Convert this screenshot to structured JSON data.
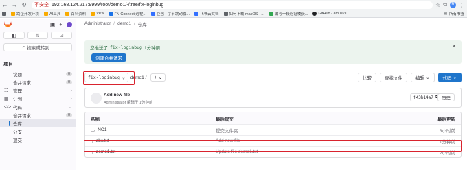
{
  "browser": {
    "insecure_label": "不安全",
    "url": "192.168.124.217:9999/root/demo1/-/tree/fix-loginbug",
    "bookmarks": [
      {
        "label": "",
        "color": "#5f6368"
      },
      {
        "label": "路企开发环境",
        "color": "#f9ab00"
      },
      {
        "label": "AI工具",
        "color": "#f9ab00"
      },
      {
        "label": "百科资料",
        "color": "#f9ab00"
      },
      {
        "label": "VPN",
        "color": "#f9ab00"
      },
      {
        "label": "FN Connect 远程...",
        "color": "#1a73e8"
      },
      {
        "label": "豆包 - 字节跳动旗...",
        "color": "#3370ff"
      },
      {
        "label": "飞书云文档",
        "color": "#3370ff"
      },
      {
        "label": "如何下载 macOS - ...",
        "color": "#5f6368"
      },
      {
        "label": "编写一段验证楼获...",
        "color": "#34a853"
      },
      {
        "label": "GitHub - amusi/IC...",
        "color": "#202124"
      }
    ],
    "bookmarks_right": "所有书签",
    "profile_initial": "R"
  },
  "sidebar": {
    "section_title": "项目",
    "search_label": "搜索或转到...",
    "items": [
      {
        "label": "议题",
        "count": "0"
      },
      {
        "label": "合并请求",
        "count": "0"
      },
      {
        "label": "管理"
      },
      {
        "label": "计划"
      },
      {
        "label": "代码"
      },
      {
        "label": "合并请求",
        "count": "0"
      },
      {
        "label": "仓库"
      },
      {
        "label": "分支"
      },
      {
        "label": "提交"
      }
    ]
  },
  "breadcrumb": [
    "Administrator",
    "demo1",
    "仓库"
  ],
  "alert": {
    "prefix": "您推送了",
    "branch": "fix-loginbug",
    "suffix": "1分钟前",
    "button": "创建合并请求"
  },
  "toolbar": {
    "branch": "fix-loginbug",
    "path": "demo1 /",
    "add": "+",
    "compare": "比较",
    "find_file": "查找文件",
    "edit": "编辑",
    "code": "代码"
  },
  "commit": {
    "title": "Add new file",
    "meta": "Administrator 编辑于 1分钟前",
    "sha": "f43b14a7",
    "history": "历史"
  },
  "table": {
    "headers": {
      "name": "名称",
      "commit": "最后提交",
      "date": "最后更新"
    },
    "rows": [
      {
        "icon": "folder-icon",
        "name": "NO1",
        "commit": "提交文件夹",
        "date": "3小时前"
      },
      {
        "icon": "file-icon",
        "name": "abc.txt",
        "commit": "Add new file",
        "date": "1分钟前"
      },
      {
        "icon": "file-icon",
        "name": "demo1.txt",
        "commit": "Update file demo1.txt",
        "date": "2小时前"
      }
    ]
  }
}
